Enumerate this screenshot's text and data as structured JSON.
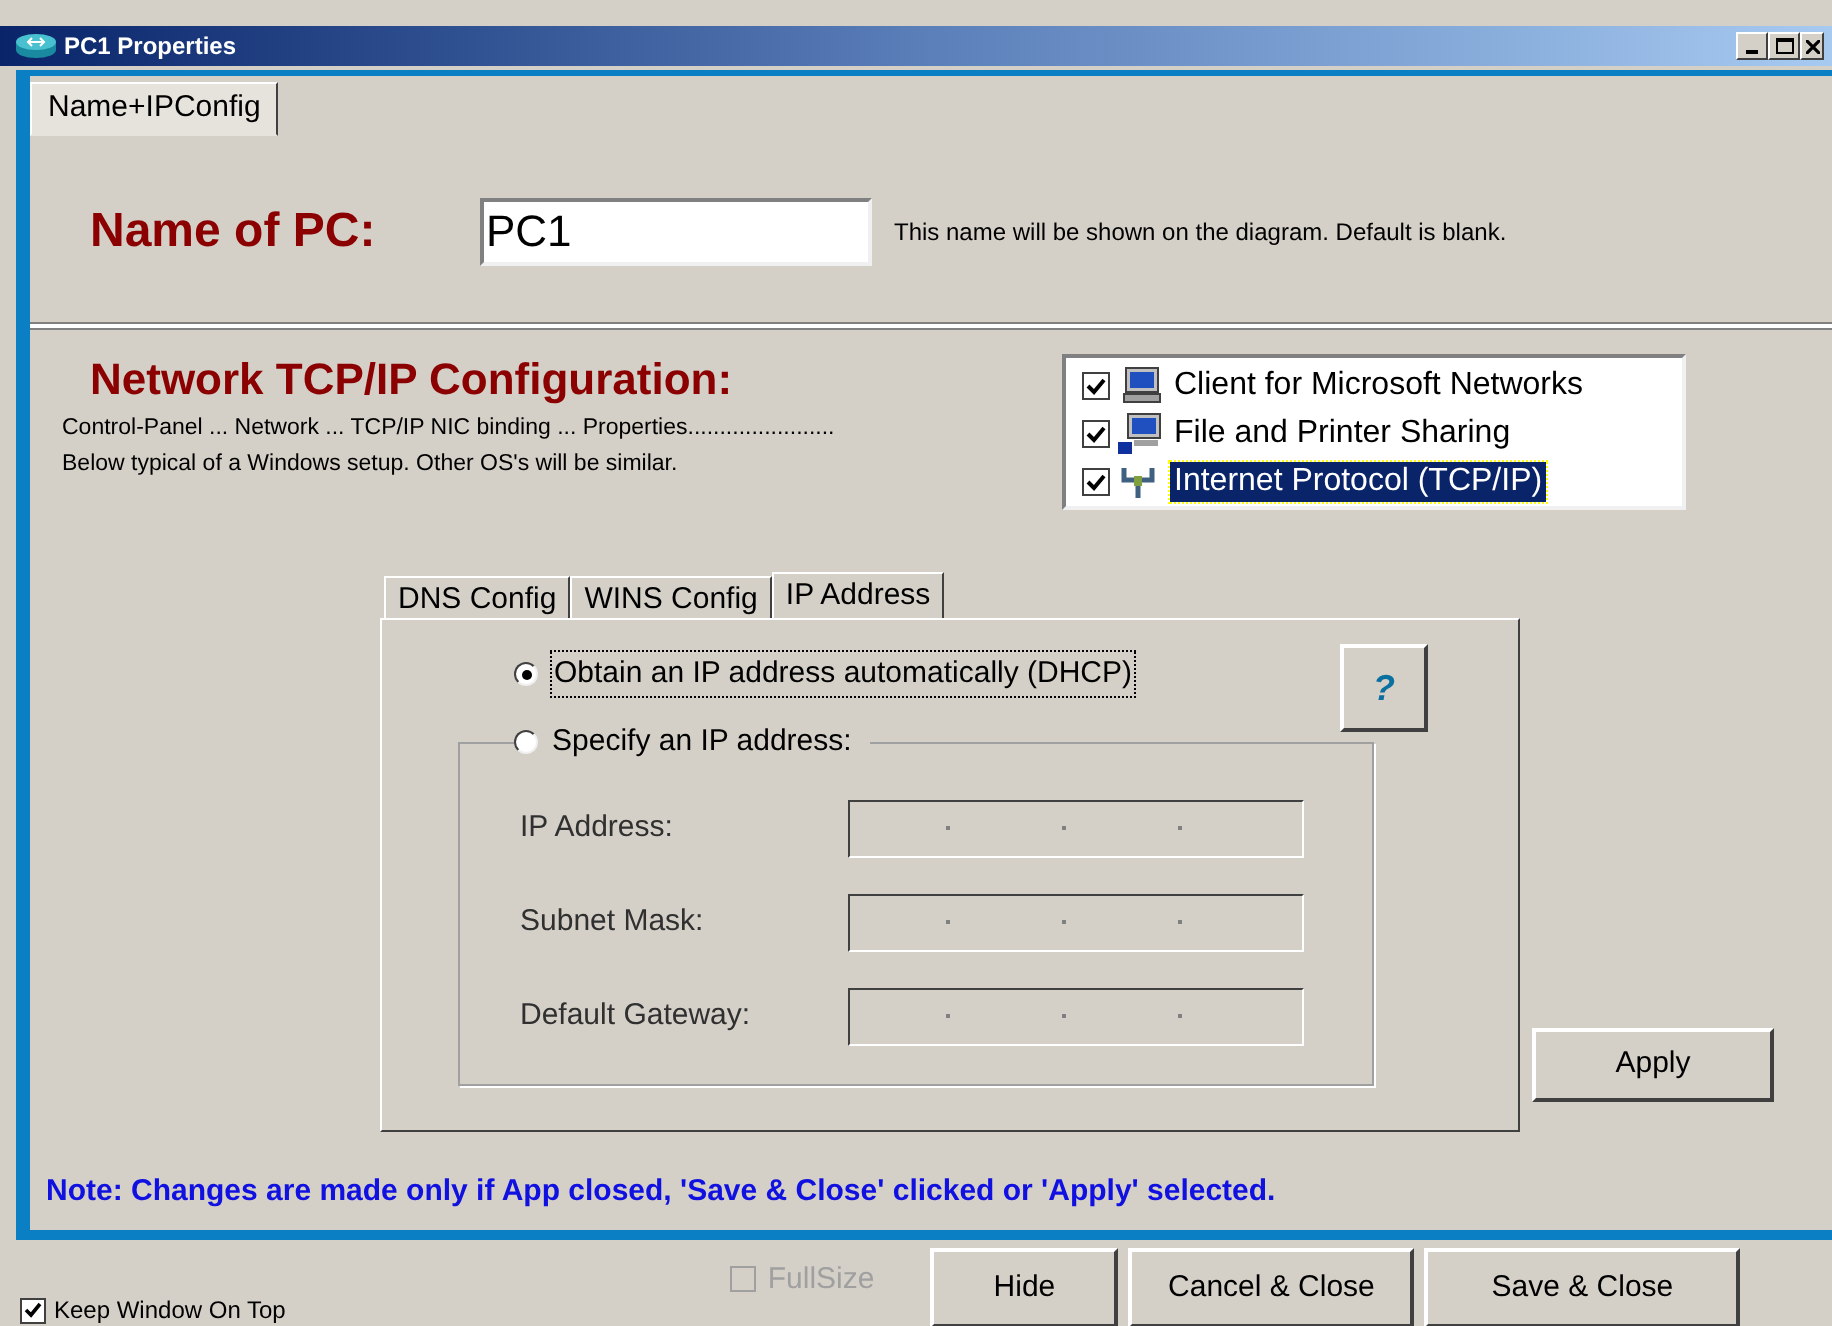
{
  "window": {
    "title": "PC1 Properties"
  },
  "tabs": [
    {
      "label": "Name+IPConfig",
      "selected": true
    }
  ],
  "name_of_pc": {
    "label": "Name of PC:",
    "value": "PC1",
    "hint": "This name will be shown on the diagram.  Default is blank."
  },
  "network": {
    "heading": "Network TCP/IP Configuration:",
    "lines": [
      "Control-Panel ... Network ... TCP/IP NIC binding ... Properties.......................",
      "Below typical of a Windows setup.  Other OS's will be similar."
    ],
    "bindings": [
      {
        "label": "Client for Microsoft Networks",
        "kind": "client",
        "checked": true,
        "selected": false
      },
      {
        "label": "File and Printer Sharing",
        "kind": "sharing",
        "checked": true,
        "selected": false
      },
      {
        "label": "Internet Protocol (TCP/IP)",
        "kind": "protocol",
        "checked": true,
        "selected": true
      }
    ]
  },
  "ip_tabs": [
    {
      "label": "DNS Config",
      "selected": false
    },
    {
      "label": "WINS Config",
      "selected": false
    },
    {
      "label": "IP Address",
      "selected": true
    }
  ],
  "ip_options": [
    {
      "label": "Obtain an IP address automatically  (DHCP)",
      "selected": true
    },
    {
      "label": "Specify an IP address:",
      "selected": false
    }
  ],
  "ip_fields": [
    {
      "label": "IP Address:"
    },
    {
      "label": "Subnet Mask:"
    },
    {
      "label": "Default Gateway:"
    }
  ],
  "help_button": "?",
  "apply_button": "Apply",
  "note": "Note: Changes are made only if App closed, 'Save & Close' clicked or 'Apply' selected.",
  "keep_on_top": {
    "label": "Keep Window On Top",
    "checked": true
  },
  "fullsize": {
    "label": "FullSize",
    "checked": false,
    "disabled": true
  },
  "buttons": [
    "Hide",
    "Cancel & Close",
    "Save & Close"
  ]
}
